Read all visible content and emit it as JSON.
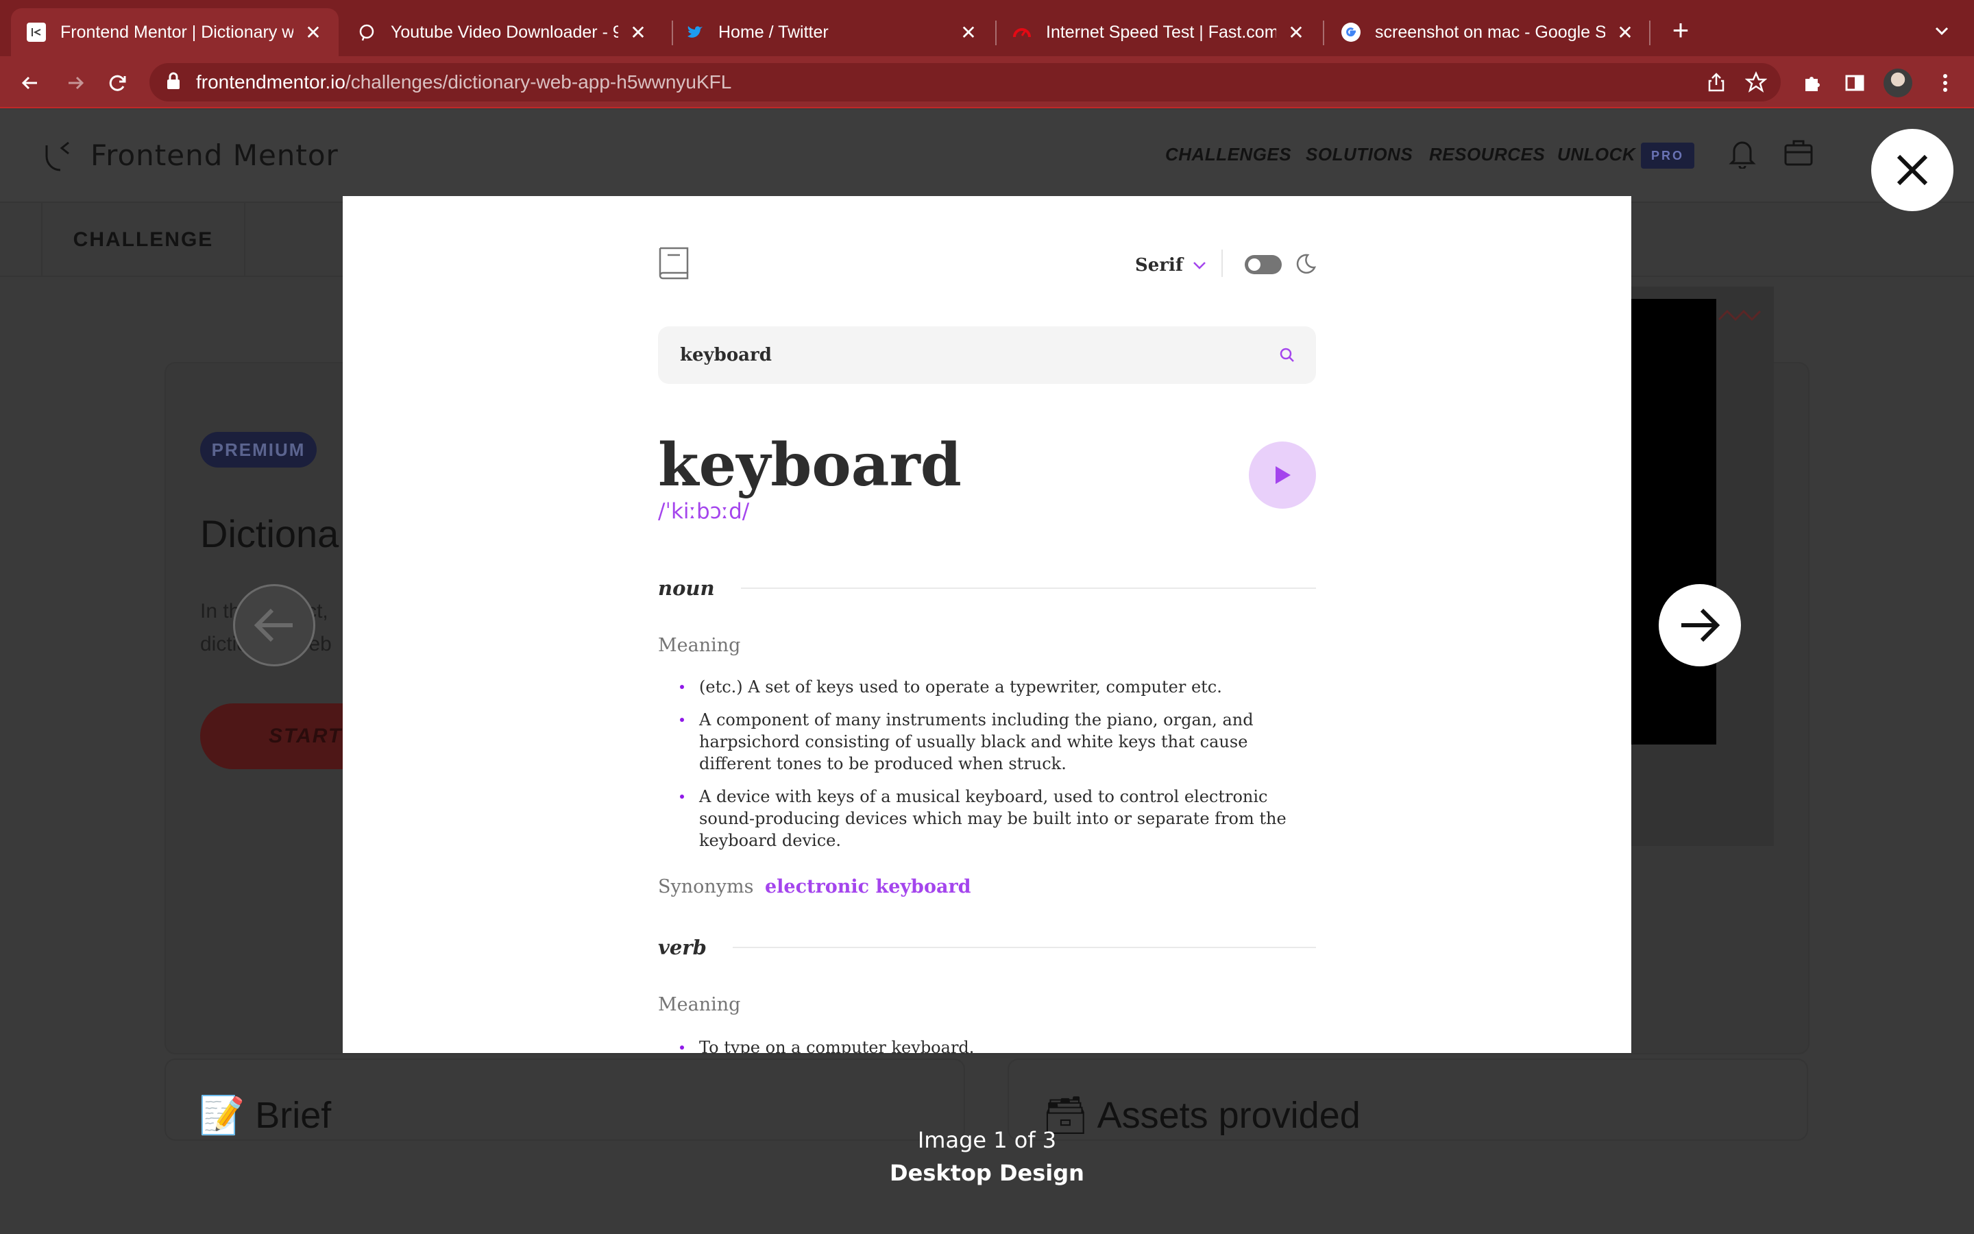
{
  "browser": {
    "tabs": [
      {
        "title": "Frontend Mentor | Dictionary w",
        "icon": "frontend-mentor-favicon",
        "active": true
      },
      {
        "title": "Youtube Video Downloader - 9",
        "icon": "ytdl-favicon",
        "active": false
      },
      {
        "title": "Home / Twitter",
        "icon": "twitter-bird-icon",
        "active": false
      },
      {
        "title": "Internet Speed Test | Fast.com",
        "icon": "fast-speedometer-icon",
        "active": false
      },
      {
        "title": "screenshot on mac - Google Se",
        "icon": "google-g-icon",
        "active": false
      }
    ],
    "new_tab": "+",
    "url_host": "frontendmentor.io",
    "url_path": "/challenges/dictionary-web-app-h5wwnyuKFL",
    "colors": {
      "tabbar": "#7a1f22",
      "toolbar": "#8f2a2d"
    }
  },
  "site": {
    "logo_text": "Frontend Mentor",
    "nav": {
      "challenges": "CHALLENGES",
      "solutions": "SOLUTIONS",
      "resources": "RESOURCES",
      "unlock": "UNLOCK",
      "pro": "PRO"
    },
    "challenge_tab": "CHALLENGE",
    "premium_badge": "PREMIUM",
    "card_title_partial": "Dictiona",
    "card_desc_partial_1": "In this project,",
    "card_desc_partial_2": "dictionary web",
    "start_button_partial": "START",
    "brief_heading": "📝 Brief",
    "assets_heading": "🗃 Assets provided"
  },
  "lightbox": {
    "counter": "Image 1 of 3",
    "caption": "Desktop Design",
    "close_icon": "close-icon",
    "prev_icon": "arrow-left-icon",
    "next_icon": "arrow-right-icon"
  },
  "dictionary_app": {
    "font_selector": "Serif",
    "search_value": "keyboard",
    "word": "keyboard",
    "phonetic": "/ˈkiːbɔːd/",
    "accent_color": "#a445ed",
    "sections": [
      {
        "part_of_speech": "noun",
        "meaning_label": "Meaning",
        "definitions": [
          "(etc.) A set of keys used to operate a typewriter, computer etc.",
          "A component of many instruments including the piano, organ, and harpsichord consisting of usually black and white keys that cause different tones to be produced when struck.",
          "A device with keys of a musical keyboard, used to control electronic sound-producing devices which may be built into or separate from the keyboard device."
        ],
        "synonyms_label": "Synonyms",
        "synonyms": "electronic keyboard"
      },
      {
        "part_of_speech": "verb",
        "meaning_label": "Meaning",
        "definitions": [
          "To type on a computer keyboard."
        ]
      }
    ]
  }
}
